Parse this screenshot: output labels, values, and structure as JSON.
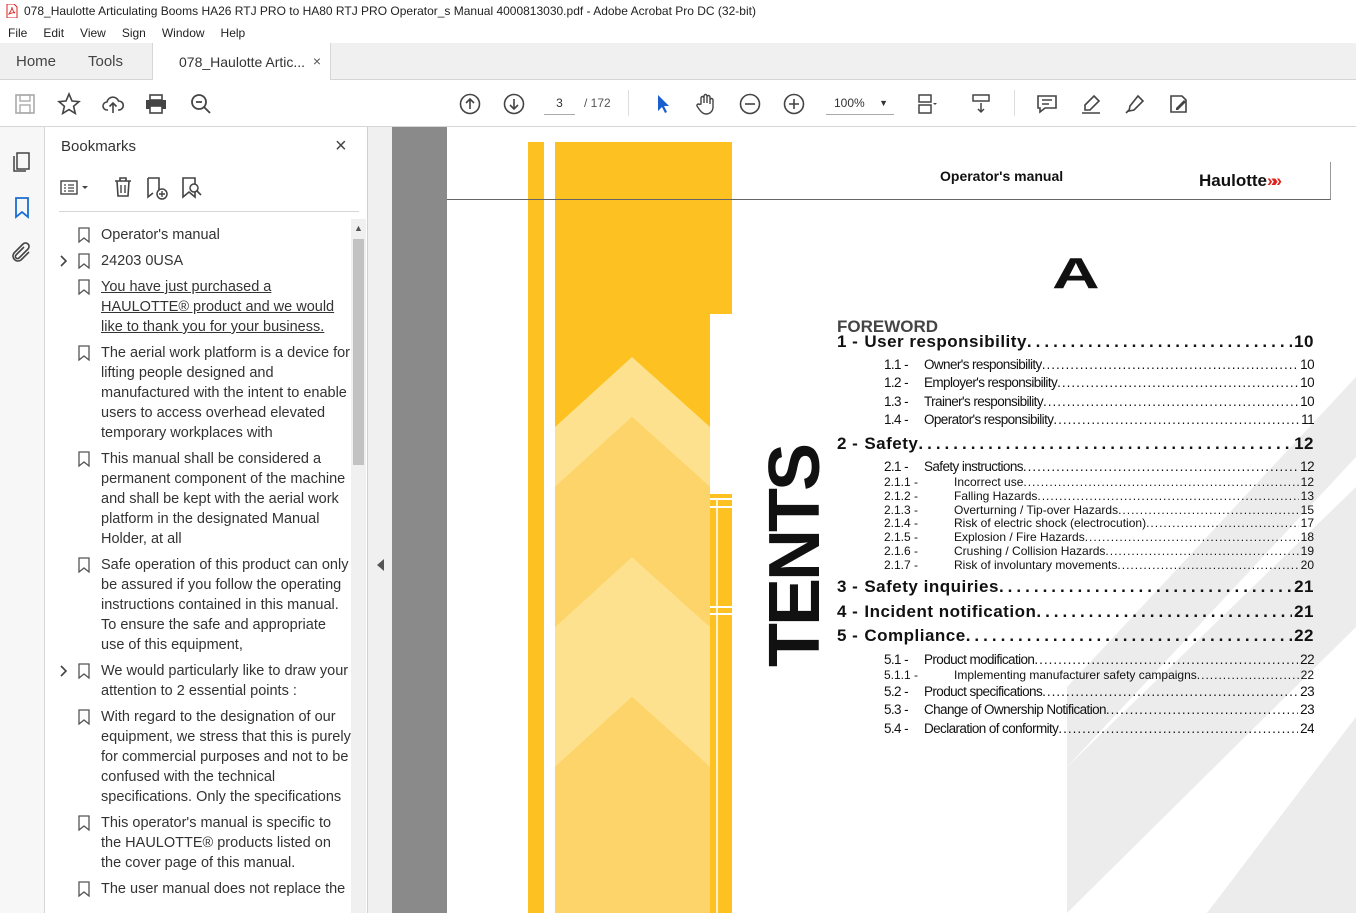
{
  "window": {
    "title": "078_Haulotte Articulating Booms HA26 RTJ PRO to HA80 RTJ PRO Operator_s Manual 4000813030.pdf - Adobe Acrobat Pro DC (32-bit)"
  },
  "menu": [
    "File",
    "Edit",
    "View",
    "Sign",
    "Window",
    "Help"
  ],
  "tabs": {
    "home": "Home",
    "tools": "Tools",
    "doc": "078_Haulotte Artic...",
    "close": "×"
  },
  "toolbar": {
    "page_current": "3",
    "page_total": "/ 172",
    "zoom": "100%"
  },
  "panel": {
    "title": "Bookmarks",
    "close": "×",
    "bookmarks": [
      {
        "text": "Operator's manual",
        "expandable": false,
        "underline": false
      },
      {
        "text": "24203 0USA",
        "expandable": true,
        "underline": false
      },
      {
        "text": "You have just purchased a HAULOTTE® product and we would like to thank you for your business.",
        "expandable": false,
        "underline": true
      },
      {
        "text": "The aerial work platform is a device for lifting people designed and manufactured with the intent to enable users to access overhead elevated temporary workplaces with",
        "expandable": false,
        "underline": false
      },
      {
        "text": "This manual shall be considered a permanent component of the machine and shall be kept with the aerial work platform in the designated Manual Holder, at all",
        "expandable": false,
        "underline": false
      },
      {
        "text": "Safe operation of this product can only be assured if you follow the operating instructions contained in this manual. To ensure the safe and appropriate use of this equipment,",
        "expandable": false,
        "underline": false
      },
      {
        "text": "We would particularly like to draw your attention to 2 essential points :",
        "expandable": true,
        "underline": false
      },
      {
        "text": "With regard to the designation of our equipment, we stress that this is purely for commercial purposes and not to be confused with the technical specifications. Only the specifications",
        "expandable": false,
        "underline": false
      },
      {
        "text": "This operator's manual is specific to the HAULOTTE® products listed on the cover page of this manual.",
        "expandable": false,
        "underline": false
      },
      {
        "text": "The user manual does not replace the",
        "expandable": false,
        "underline": false
      }
    ]
  },
  "document": {
    "header_title": "Operator's manual",
    "brand": "Haulotte",
    "section_letter": "A",
    "foreword": "FOREWORD",
    "side_text": "TENTS",
    "toc": [
      {
        "level": 1,
        "num": "1 -",
        "label": "User responsibility",
        "page": "10"
      },
      {
        "level": 2,
        "num": "1.1 -",
        "label": "Owner's responsibility",
        "page": "10"
      },
      {
        "level": 2,
        "num": "1.2 -",
        "label": "Employer's responsibility",
        "page": "10"
      },
      {
        "level": 2,
        "num": "1.3 -",
        "label": "Trainer's responsibility",
        "page": "10"
      },
      {
        "level": 2,
        "num": "1.4 -",
        "label": "Operator's responsibility",
        "page": "11"
      },
      {
        "level": 1,
        "num": "2 -",
        "label": "Safety",
        "page": "12"
      },
      {
        "level": 2,
        "num": "2.1 -",
        "label": "Safety instructions",
        "page": "12"
      },
      {
        "level": 3,
        "num": "2.1.1 -",
        "label": "Incorrect use",
        "page": "12"
      },
      {
        "level": 3,
        "num": "2.1.2 -",
        "label": "Falling Hazards",
        "page": "13"
      },
      {
        "level": 3,
        "num": "2.1.3 -",
        "label": "Overturning / Tip-over Hazards",
        "page": "15"
      },
      {
        "level": 3,
        "num": "2.1.4 -",
        "label": "Risk of electric shock (electrocution)",
        "page": "17"
      },
      {
        "level": 3,
        "num": "2.1.5 -",
        "label": "Explosion / Fire Hazards",
        "page": "18"
      },
      {
        "level": 3,
        "num": "2.1.6 -",
        "label": "Crushing / Collision Hazards",
        "page": "19"
      },
      {
        "level": 3,
        "num": "2.1.7 -",
        "label": "Risk of involuntary movements",
        "page": "20"
      },
      {
        "level": 1,
        "num": "3 -",
        "label": "Safety inquiries",
        "page": "21"
      },
      {
        "level": 1,
        "num": "4 -",
        "label": "Incident notification",
        "page": "21"
      },
      {
        "level": 1,
        "num": "5 -",
        "label": "Compliance",
        "page": "22"
      },
      {
        "level": 2,
        "num": "5.1 -",
        "label": "Product modification",
        "page": "22"
      },
      {
        "level": 3,
        "num": "5.1.1 -",
        "label": "Implementing manufacturer safety campaigns",
        "page": "22"
      },
      {
        "level": 2,
        "num": "5.2 -",
        "label": "Product specifications",
        "page": "23"
      },
      {
        "level": 2,
        "num": "5.3 -",
        "label": "Change of Ownership Notification",
        "page": "23"
      },
      {
        "level": 2,
        "num": "5.4 -",
        "label": "Declaration of conformity",
        "page": "24"
      }
    ]
  },
  "colors": {
    "accent_yellow": "#fdc221",
    "brand_red": "#e1211b",
    "viewer_bg": "#8a8a8a"
  }
}
